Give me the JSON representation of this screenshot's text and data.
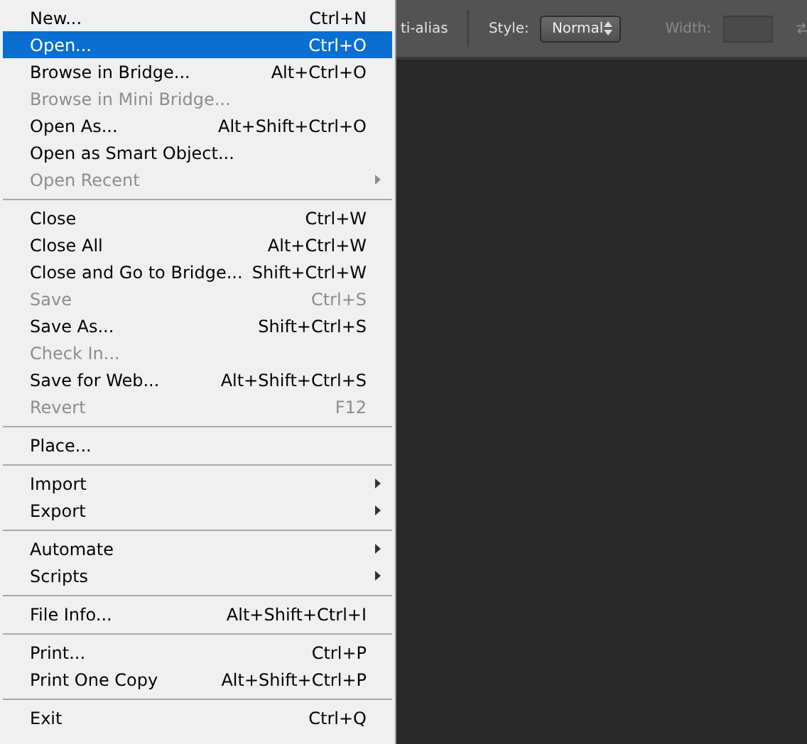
{
  "options_bar": {
    "antialias_fragment": "ti-alias",
    "style_label": "Style:",
    "style_value": "Normal",
    "width_label": "Width:",
    "width_disabled": true
  },
  "menu": {
    "groups": [
      [
        {
          "label": "New...",
          "shortcut": "Ctrl+N",
          "disabled": false,
          "selected": false,
          "submenu": false
        },
        {
          "label": "Open...",
          "shortcut": "Ctrl+O",
          "disabled": false,
          "selected": true,
          "submenu": false
        },
        {
          "label": "Browse in Bridge...",
          "shortcut": "Alt+Ctrl+O",
          "disabled": false,
          "selected": false,
          "submenu": false
        },
        {
          "label": "Browse in Mini Bridge...",
          "disabled": true,
          "selected": false,
          "submenu": false
        },
        {
          "label": "Open As...",
          "shortcut": "Alt+Shift+Ctrl+O",
          "disabled": false,
          "selected": false,
          "submenu": false
        },
        {
          "label": "Open as Smart Object...",
          "disabled": false,
          "selected": false,
          "submenu": false
        },
        {
          "label": "Open Recent",
          "disabled": true,
          "selected": false,
          "submenu": true
        }
      ],
      [
        {
          "label": "Close",
          "shortcut": "Ctrl+W",
          "disabled": false,
          "selected": false,
          "submenu": false
        },
        {
          "label": "Close All",
          "shortcut": "Alt+Ctrl+W",
          "disabled": false,
          "selected": false,
          "submenu": false
        },
        {
          "label": "Close and Go to Bridge...",
          "shortcut": "Shift+Ctrl+W",
          "disabled": false,
          "selected": false,
          "submenu": false
        },
        {
          "label": "Save",
          "shortcut": "Ctrl+S",
          "disabled": true,
          "selected": false,
          "submenu": false
        },
        {
          "label": "Save As...",
          "shortcut": "Shift+Ctrl+S",
          "disabled": false,
          "selected": false,
          "submenu": false
        },
        {
          "label": "Check In...",
          "disabled": true,
          "selected": false,
          "submenu": false
        },
        {
          "label": "Save for Web...",
          "shortcut": "Alt+Shift+Ctrl+S",
          "disabled": false,
          "selected": false,
          "submenu": false
        },
        {
          "label": "Revert",
          "shortcut": "F12",
          "disabled": true,
          "selected": false,
          "submenu": false
        }
      ],
      [
        {
          "label": "Place...",
          "disabled": false,
          "selected": false,
          "submenu": false
        }
      ],
      [
        {
          "label": "Import",
          "disabled": false,
          "selected": false,
          "submenu": true
        },
        {
          "label": "Export",
          "disabled": false,
          "selected": false,
          "submenu": true
        }
      ],
      [
        {
          "label": "Automate",
          "disabled": false,
          "selected": false,
          "submenu": true
        },
        {
          "label": "Scripts",
          "disabled": false,
          "selected": false,
          "submenu": true
        }
      ],
      [
        {
          "label": "File Info...",
          "shortcut": "Alt+Shift+Ctrl+I",
          "disabled": false,
          "selected": false,
          "submenu": false
        }
      ],
      [
        {
          "label": "Print...",
          "shortcut": "Ctrl+P",
          "disabled": false,
          "selected": false,
          "submenu": false
        },
        {
          "label": "Print One Copy",
          "shortcut": "Alt+Shift+Ctrl+P",
          "disabled": false,
          "selected": false,
          "submenu": false
        }
      ],
      [
        {
          "label": "Exit",
          "shortcut": "Ctrl+Q",
          "disabled": false,
          "selected": false,
          "submenu": false
        }
      ]
    ]
  }
}
